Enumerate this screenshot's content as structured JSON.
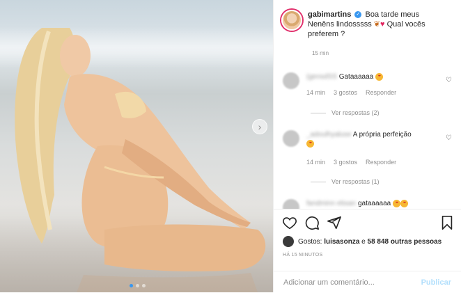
{
  "post": {
    "username": "gabimartins",
    "caption_lines": [
      "Boa tarde meus",
      "Neněns lindosssss",
      "Qual vocês",
      "preferem ?"
    ],
    "time": "15 min"
  },
  "comments": [
    {
      "user": "(gensdSS",
      "text": "Gataaaaaa",
      "time": "14 min",
      "likes": "3 gostos",
      "reply": "Responder",
      "view_replies": "Ver respostas (2)"
    },
    {
      "user": "_adoulhyaluse",
      "text": "A própria perfeição",
      "time": "14 min",
      "likes": "3 gostos",
      "reply": "Responder",
      "view_replies": "Ver respostas (1)"
    },
    {
      "user": "fandminn ebsan",
      "text": "gataaaaaa"
    }
  ],
  "likes": {
    "prefix": "Gostos:",
    "user": "luisasonza",
    "middle": "e",
    "count": "58 848 outras pessoas"
  },
  "posted_ago": "HÁ 15 MINUTOS",
  "comment_box": {
    "placeholder": "Adicionar um comentário...",
    "publish": "Publicar"
  },
  "colors": {
    "accent": "#3897f0",
    "publish_disabled": "#b2dffc",
    "meta": "#8e8e8e"
  },
  "icons": [
    "heart-icon",
    "comment-icon",
    "share-icon",
    "bookmark-icon",
    "chevron-right-icon",
    "verified-icon"
  ]
}
